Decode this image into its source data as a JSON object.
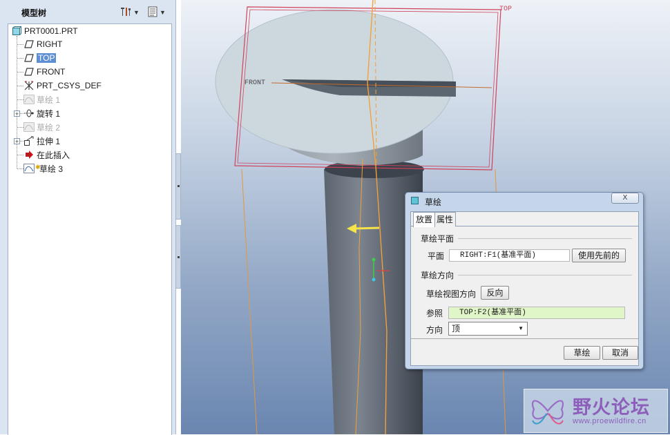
{
  "model_tree": {
    "title": "模型树",
    "tools": [
      {
        "name": "tree-settings",
        "icon": "tools-icon"
      },
      {
        "name": "tree-columns",
        "icon": "list-icon"
      }
    ],
    "items": [
      {
        "label": "PRT0001.PRT",
        "icon": "part-icon",
        "state": "normal"
      },
      {
        "label": "RIGHT",
        "icon": "datum-plane-icon",
        "state": "normal"
      },
      {
        "label": "TOP",
        "icon": "datum-plane-icon",
        "state": "selected"
      },
      {
        "label": "FRONT",
        "icon": "datum-plane-icon",
        "state": "normal"
      },
      {
        "label": "PRT_CSYS_DEF",
        "icon": "csys-icon",
        "state": "normal"
      },
      {
        "label": "草绘 1",
        "icon": "sketch-icon",
        "state": "dimmed"
      },
      {
        "label": "旋转 1",
        "icon": "revolve-icon",
        "state": "normal",
        "expandable": true
      },
      {
        "label": "草绘 2",
        "icon": "sketch-icon",
        "state": "dimmed"
      },
      {
        "label": "拉伸 1",
        "icon": "extrude-icon",
        "state": "normal",
        "expandable": true
      },
      {
        "label": "在此插入",
        "icon": "insert-arrow-icon",
        "state": "normal"
      },
      {
        "label": "草绘 3",
        "icon": "sketch-new-icon",
        "state": "normal"
      }
    ]
  },
  "graphics": {
    "datum_labels": {
      "top": "TOP",
      "front": "FRONT"
    }
  },
  "dialog": {
    "title": "草绘",
    "close_label": "X",
    "tabs": [
      {
        "label": "放置",
        "active": true
      },
      {
        "label": "属性",
        "active": false
      }
    ],
    "sketch_plane_section": "草绘平面",
    "plane_label": "平面",
    "plane_value": "RIGHT:F1(基准平面)",
    "use_previous_button": "使用先前的",
    "orientation_section": "草绘方向",
    "view_direction_label": "草绘视图方向",
    "flip_button": "反向",
    "reference_label": "参照",
    "reference_value": "TOP:F2(基准平面)",
    "direction_label": "方向",
    "direction_value": "顶",
    "sketch_button": "草绘",
    "cancel_button": "取消"
  },
  "watermark": {
    "title": "野火论坛",
    "url": "www.proewildfire.cn"
  }
}
